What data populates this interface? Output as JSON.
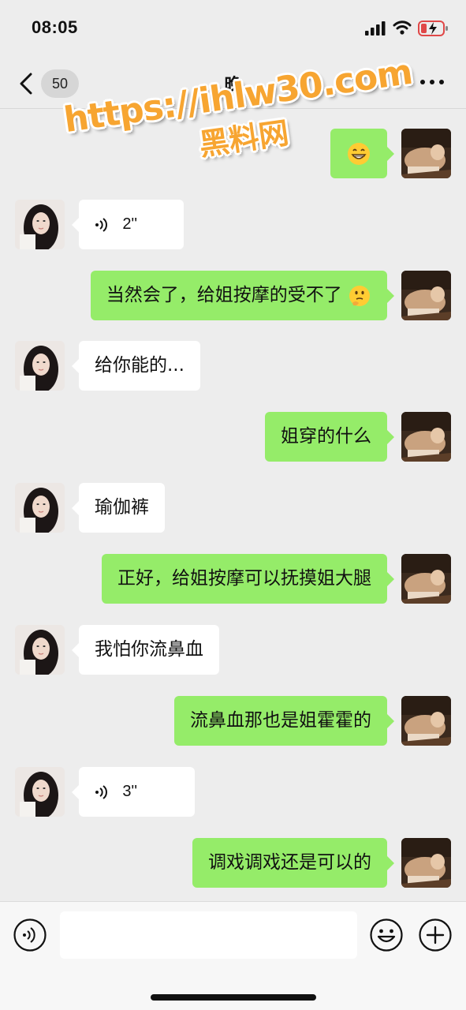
{
  "status_bar": {
    "time": "08:05"
  },
  "nav": {
    "unread_count": "50",
    "title": "晚"
  },
  "watermark": {
    "url": "https://ihlw30.com",
    "name": "黑料网"
  },
  "messages": [
    {
      "side": "out",
      "type": "emoji",
      "emoji": "😁"
    },
    {
      "side": "in",
      "type": "voice",
      "duration": "2''"
    },
    {
      "side": "out",
      "type": "text",
      "text": "当然会了，给姐按摩的受不了",
      "emoji": "🤔"
    },
    {
      "side": "in",
      "type": "text",
      "text": "给你能的..."
    },
    {
      "side": "out",
      "type": "text",
      "text": "姐穿的什么"
    },
    {
      "side": "in",
      "type": "text",
      "text": "瑜伽裤"
    },
    {
      "side": "out",
      "type": "text",
      "text": "正好，给姐按摩可以抚摸姐大腿"
    },
    {
      "side": "in",
      "type": "text",
      "text": "我怕你流鼻血"
    },
    {
      "side": "out",
      "type": "text",
      "text": "流鼻血那也是姐霍霍的"
    },
    {
      "side": "in",
      "type": "voice",
      "duration": "3''"
    },
    {
      "side": "out",
      "type": "text",
      "text": "调戏调戏还是可以的"
    }
  ],
  "input": {
    "value": "",
    "placeholder": ""
  },
  "colors": {
    "background": "#ededed",
    "outgoing_bubble": "#95ec69",
    "incoming_bubble": "#ffffff",
    "watermark": "#f7a531"
  }
}
